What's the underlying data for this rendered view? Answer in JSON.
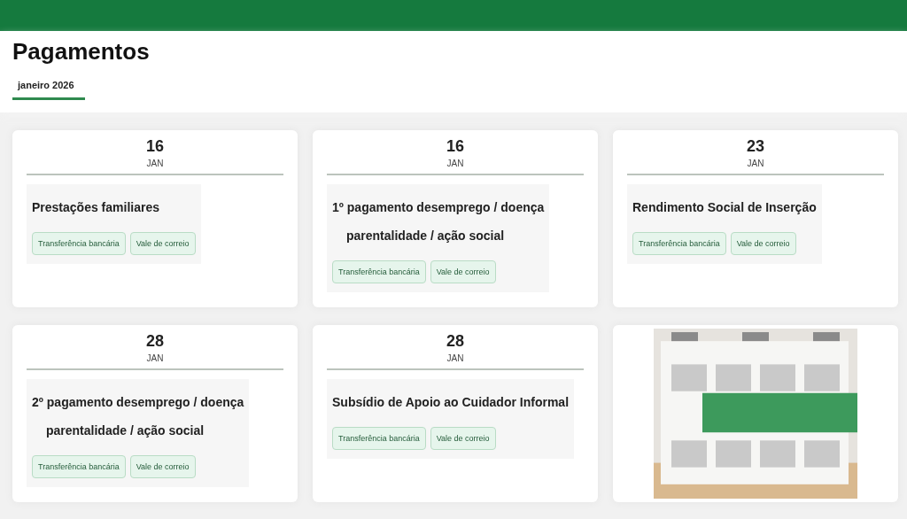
{
  "page": {
    "title": "Pagamentos"
  },
  "tabs": [
    {
      "label": "janeiro 2026",
      "selected": true
    }
  ],
  "cards": [
    {
      "kind": "payment",
      "day": "16",
      "month": "JAN",
      "title_lines": [
        "Prestações familiares"
      ],
      "methods": [
        "Transferência bancária",
        "Vale de correio"
      ]
    },
    {
      "kind": "payment",
      "day": "16",
      "month": "JAN",
      "title_lines": [
        "1º pagamento desemprego / doença",
        "parentalidade / ação social"
      ],
      "methods": [
        "Transferência bancária",
        "Vale de correio"
      ]
    },
    {
      "kind": "payment",
      "day": "23",
      "month": "JAN",
      "title_lines": [
        "Rendimento Social de Inserção"
      ],
      "methods": [
        "Transferência bancária",
        "Vale de correio"
      ]
    },
    {
      "kind": "payment",
      "day": "28",
      "month": "JAN",
      "title_lines": [
        "2º pagamento desemprego / doença",
        "parentalidade / ação social"
      ],
      "methods": [
        "Transferência bancária",
        "Vale de correio"
      ]
    },
    {
      "kind": "payment",
      "day": "28",
      "month": "JAN",
      "title_lines": [
        "Subsídio de Apoio ao Cuidador Informal"
      ],
      "methods": [
        "Transferência bancária",
        "Vale de correio"
      ]
    },
    {
      "kind": "picture"
    }
  ]
}
